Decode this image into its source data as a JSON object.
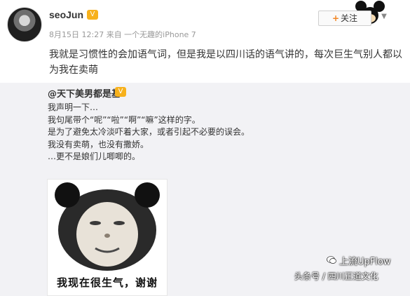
{
  "post": {
    "username": "seoJun",
    "badge": "V",
    "meta": "8月15日 12:27 来自 一个无趣的iPhone 7",
    "text": "我就是习惯性的会加语气词，但是我是以四川话的语气讲的，每次巨生气别人都以为我在卖萌",
    "follow_label": "关注"
  },
  "repost": {
    "author": "@天下美男都是基",
    "badge": "V",
    "lines": [
      "我声明一下…",
      "我句尾带个“呢”“啦”“啊”“嘛”这样的字。",
      "是为了避免太冷淡吓着大家，或者引起不必要的误会。",
      "我没有卖萌，也没有撒娇。",
      "…更不是娘们儿唧唧的。"
    ],
    "meme_caption": "我现在很生气，谢谢"
  },
  "watermark": {
    "logo_text": "上流UpFlow",
    "source": "头条号 / 四川正道文化"
  },
  "icons": {
    "chevron": "chevron-down-icon",
    "wechat": "wechat-icon",
    "mickey": "mickey-mouse-icon"
  }
}
